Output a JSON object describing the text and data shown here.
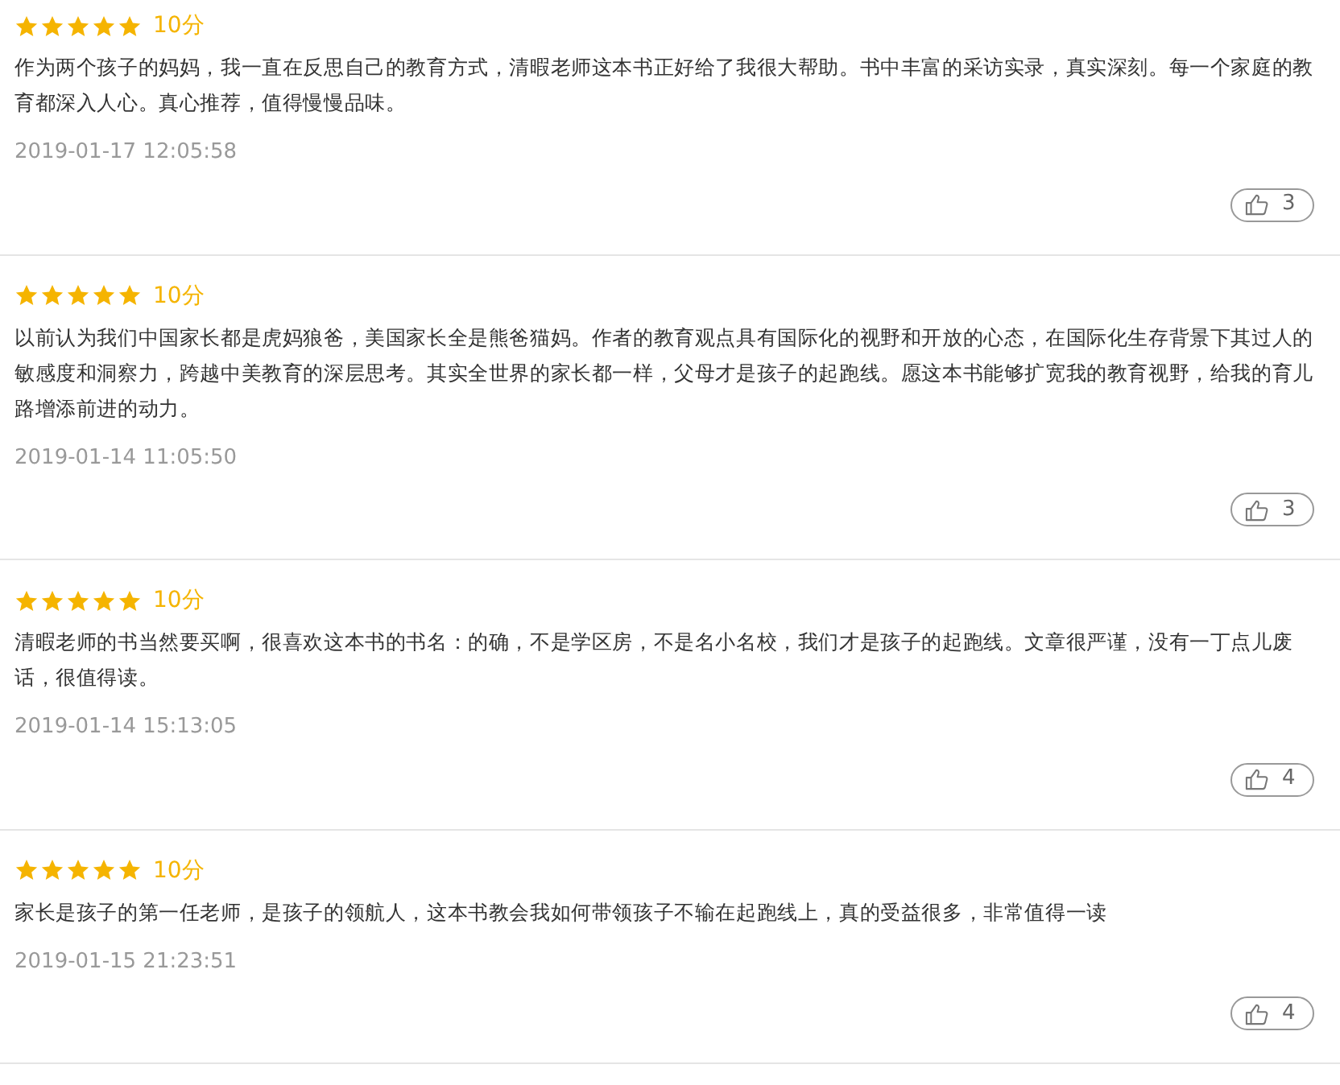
{
  "reviews": [
    {
      "stars": 5,
      "score": "10分",
      "text": "作为两个孩子的妈妈，我一直在反思自己的教育方式，清暇老师这本书正好给了我很大帮助。书中丰富的采访实录，真实深刻。每一个家庭的教育都深入人心。真心推荐，值得慢慢品味。",
      "date": "2019-01-17 12:05:58",
      "likes": "3"
    },
    {
      "stars": 5,
      "score": "10分",
      "text": "以前认为我们中国家长都是虎妈狼爸，美国家长全是熊爸猫妈。作者的教育观点具有国际化的视野和开放的心态，在国际化生存背景下其过人的敏感度和洞察力，跨越中美教育的深层思考。其实全世界的家长都一样，父母才是孩子的起跑线。愿这本书能够扩宽我的教育视野，给我的育儿路增添前进的动力。",
      "date": "2019-01-14 11:05:50",
      "likes": "3"
    },
    {
      "stars": 5,
      "score": "10分",
      "text": "清暇老师的书当然要买啊，很喜欢这本书的书名：的确，不是学区房，不是名小名校，我们才是孩子的起跑线。文章很严谨，没有一丁点儿废话，很值得读。",
      "date": "2019-01-14 15:13:05",
      "likes": "4"
    },
    {
      "stars": 5,
      "score": "10分",
      "text": "家长是孩子的第一任老师，是孩子的领航人，这本书教会我如何带领孩子不输在起跑线上，真的受益很多，非常值得一读",
      "date": "2019-01-15 21:23:51",
      "likes": "4"
    }
  ]
}
